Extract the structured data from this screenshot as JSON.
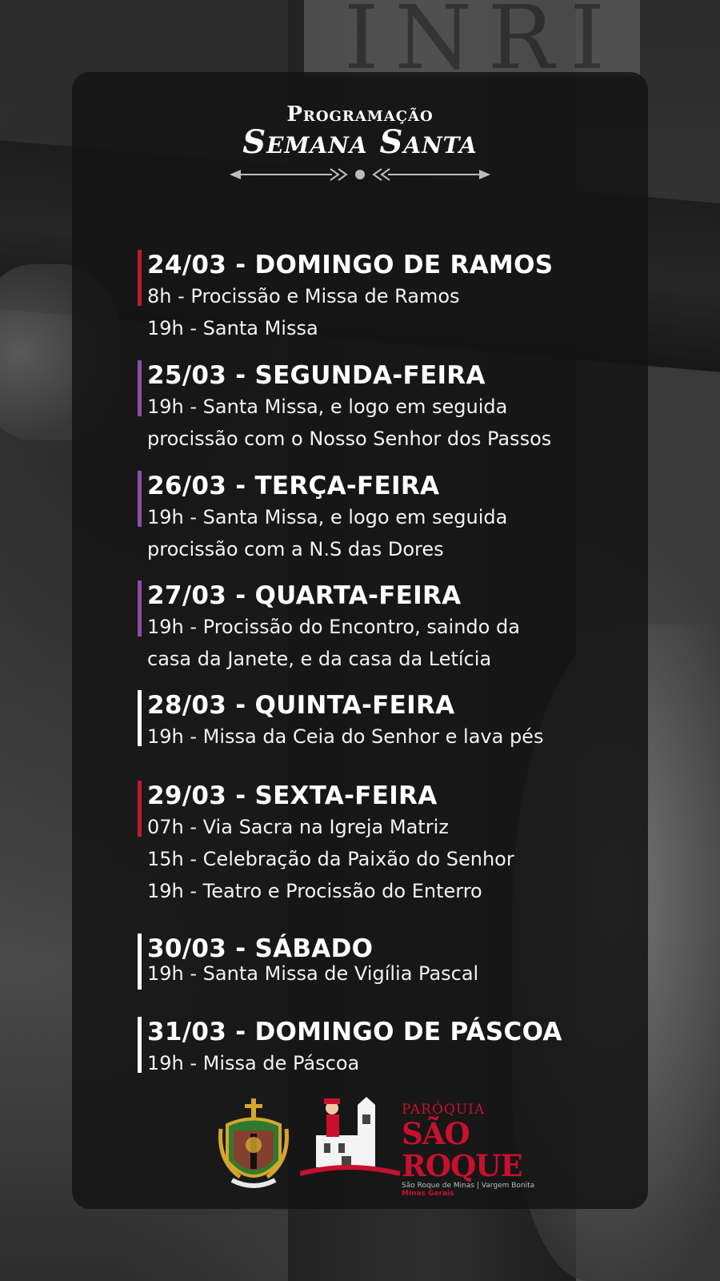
{
  "header": {
    "title_line1": "Programação",
    "title_line2": "Semana Santa"
  },
  "colors": {
    "red": "#b81f2d",
    "purple": "#8b4fa6",
    "white": "#ffffff"
  },
  "events": [
    {
      "date": "24/03 - DOMINGO DE RAMOS",
      "bar_color": "red",
      "lines": [
        "8h - Procissão e Missa de Ramos",
        "19h - Santa Missa"
      ]
    },
    {
      "date": "25/03 - SEGUNDA-FEIRA",
      "bar_color": "purple",
      "lines": [
        "19h - Santa Missa, e logo em seguida",
        "procissão com o Nosso Senhor dos Passos"
      ]
    },
    {
      "date": "26/03 - TERÇA-FEIRA",
      "bar_color": "purple",
      "lines": [
        "19h - Santa Missa, e logo em seguida",
        "procissão com a N.S das Dores"
      ]
    },
    {
      "date": "27/03 - QUARTA-FEIRA",
      "bar_color": "purple",
      "lines": [
        "19h - Procissão do Encontro, saindo da",
        "casa da Janete, e da casa da Letícia"
      ]
    },
    {
      "date": "28/03 - QUINTA-FEIRA",
      "bar_color": "white",
      "lines": [
        "19h - Missa da Ceia do Senhor e lava pés"
      ]
    },
    {
      "date": "29/03 - SEXTA-FEIRA",
      "bar_color": "red",
      "lines": [
        "07h - Via Sacra na Igreja Matriz",
        "15h - Celebração da Paixão do Senhor",
        "19h - Teatro e Procissão do Enterro"
      ]
    },
    {
      "date": "30/03 - SÁBADO",
      "bar_color": "white",
      "lines": [
        "19h - Santa Missa de Vigília Pascal"
      ]
    },
    {
      "date": "31/03 - DOMINGO DE PÁSCOA",
      "bar_color": "white",
      "lines": [
        "19h - Missa de Páscoa"
      ]
    }
  ],
  "footer": {
    "parish_label": "PARÓQUIA",
    "parish_name": "SÃO ROQUE",
    "location": "São Roque de Minas | Vargem Bonita",
    "state": "Minas Gerais"
  }
}
